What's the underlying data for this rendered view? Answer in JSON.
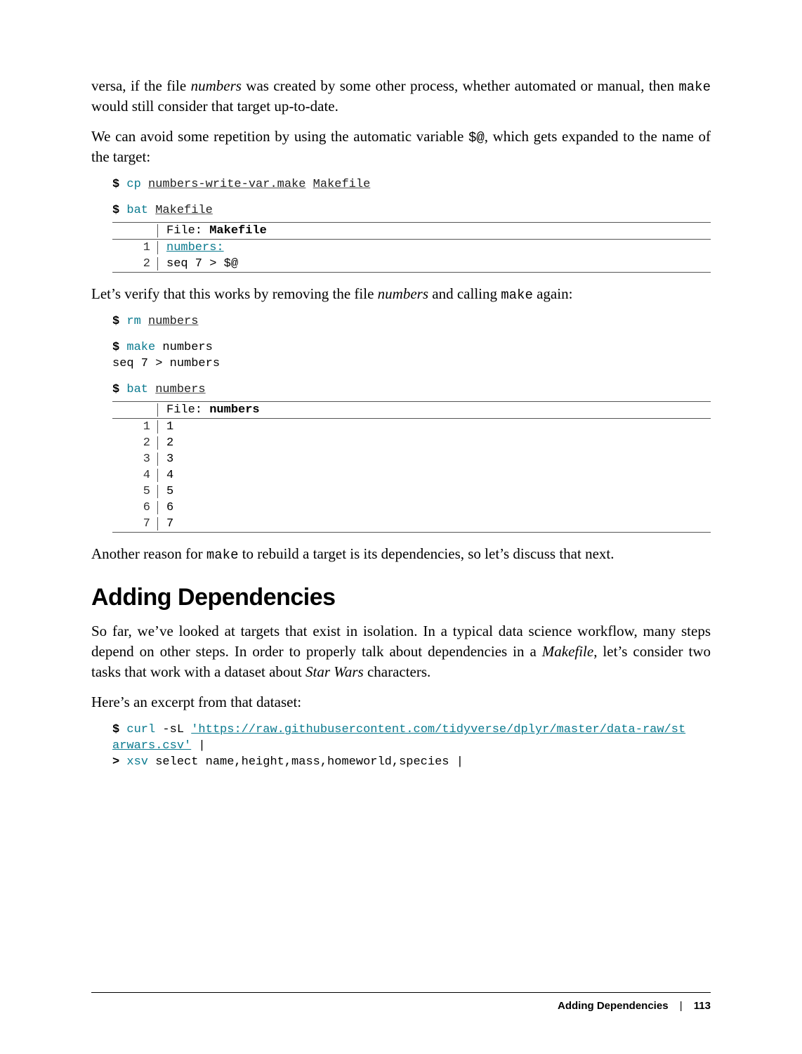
{
  "para1_a": "versa, if the file ",
  "para1_b": "numbers",
  "para1_c": " was created by some other process, whether automated or manual, then ",
  "para1_d": "make",
  "para1_e": " would still consider that target up-to-date.",
  "para2_a": "We can avoid some repetition by using the automatic variable ",
  "para2_b": "$@",
  "para2_c": ", which gets expan­ded to the name of the target:",
  "cmd1": {
    "cmd": "cp",
    "arg1": "numbers-write-var.make",
    "arg2": "Makefile"
  },
  "cmd2": {
    "cmd": "bat",
    "arg1": "Makefile"
  },
  "bat1": {
    "file_label": "File: ",
    "file_name": "Makefile",
    "rows": [
      {
        "n": "1",
        "text": "numbers:",
        "cls": "cmd-under"
      },
      {
        "n": "2",
        "text": "        seq 7 > $@"
      }
    ]
  },
  "para3_a": "Let’s verify that this works by removing the file ",
  "para3_b": "numbers",
  "para3_c": " and calling ",
  "para3_d": "make",
  "para3_e": " again:",
  "cmd3": {
    "cmd": "rm",
    "arg1": "numbers"
  },
  "cmd4": {
    "cmd": "make",
    "arg1": "numbers",
    "out": "seq 7 > numbers"
  },
  "cmd5": {
    "cmd": "bat",
    "arg1": "numbers"
  },
  "bat2": {
    "file_label": "File: ",
    "file_name": "numbers",
    "rows": [
      {
        "n": "1",
        "text": "1"
      },
      {
        "n": "2",
        "text": "2"
      },
      {
        "n": "3",
        "text": "3"
      },
      {
        "n": "4",
        "text": "4"
      },
      {
        "n": "5",
        "text": "5"
      },
      {
        "n": "6",
        "text": "6"
      },
      {
        "n": "7",
        "text": "7"
      }
    ]
  },
  "para4_a": "Another reason for ",
  "para4_b": "make",
  "para4_c": " to rebuild a target is its dependencies, so let’s discuss that next.",
  "heading": "Adding Dependencies",
  "para5_a": "So far, we’ve looked at targets that exist in isolation. In a typical data science work­flow, many steps depend on other steps. In order to properly talk about dependencies in a ",
  "para5_b": "Makefile",
  "para5_c": ", let’s consider two tasks that work with a dataset about ",
  "para5_d": "Star Wars",
  "para5_e": " characters.",
  "para6": "Here’s an excerpt from that dataset:",
  "cmd6": {
    "cmd": "curl",
    "flags": "-sL",
    "url_a": "'https://raw.githubusercontent.com/tidyverse/dplyr/master/data-raw/st",
    "url_b": "arwars.csv'",
    "pipe": "|",
    "gt": ">",
    "cmd2": "xsv",
    "rest": "select name,height,mass,homeworld,species |"
  },
  "footer": {
    "title": "Adding Dependencies",
    "page": "113"
  }
}
